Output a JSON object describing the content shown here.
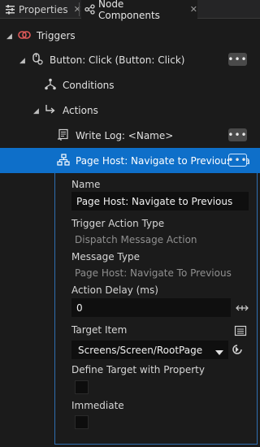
{
  "tabs": [
    {
      "label": "Properties",
      "icon": "properties-icon",
      "close": "✕"
    },
    {
      "label": "Node Components",
      "icon": "node-components-icon",
      "close": "✕"
    }
  ],
  "tree": {
    "triggers": {
      "label": "Triggers",
      "icon": "triggers-icon"
    },
    "button_click": {
      "label": "Button: Click (Button: Click)",
      "icon": "click-trigger-icon",
      "more": "•••"
    },
    "conditions": {
      "label": "Conditions",
      "icon": "conditions-icon"
    },
    "actions": {
      "label": "Actions",
      "icon": "actions-icon"
    },
    "write_log": {
      "label": "Write Log: <Name>",
      "icon": "write-log-icon",
      "more": "•••"
    },
    "page_host": {
      "label": "Page Host: Navigate to Previous (Pa",
      "icon": "page-host-icon",
      "more": "•••"
    }
  },
  "panel": {
    "name_label": "Name",
    "name_value": "Page Host: Navigate to Previous",
    "trigger_action_type_label": "Trigger Action Type",
    "trigger_action_type_value": "Dispatch Message Action",
    "message_type_label": "Message Type",
    "message_type_value": "Page Host: Navigate To Previous",
    "action_delay_label": "Action Delay (ms)",
    "action_delay_value": "0",
    "target_item_label": "Target Item",
    "target_item_value": "Screens/Screen/RootPage",
    "define_target_label": "Define Target with Property",
    "immediate_label": "Immediate"
  },
  "colors": {
    "selection": "#0e6fc9",
    "trigger_icon": "#e05a5a",
    "background": "#1b1b1b"
  }
}
